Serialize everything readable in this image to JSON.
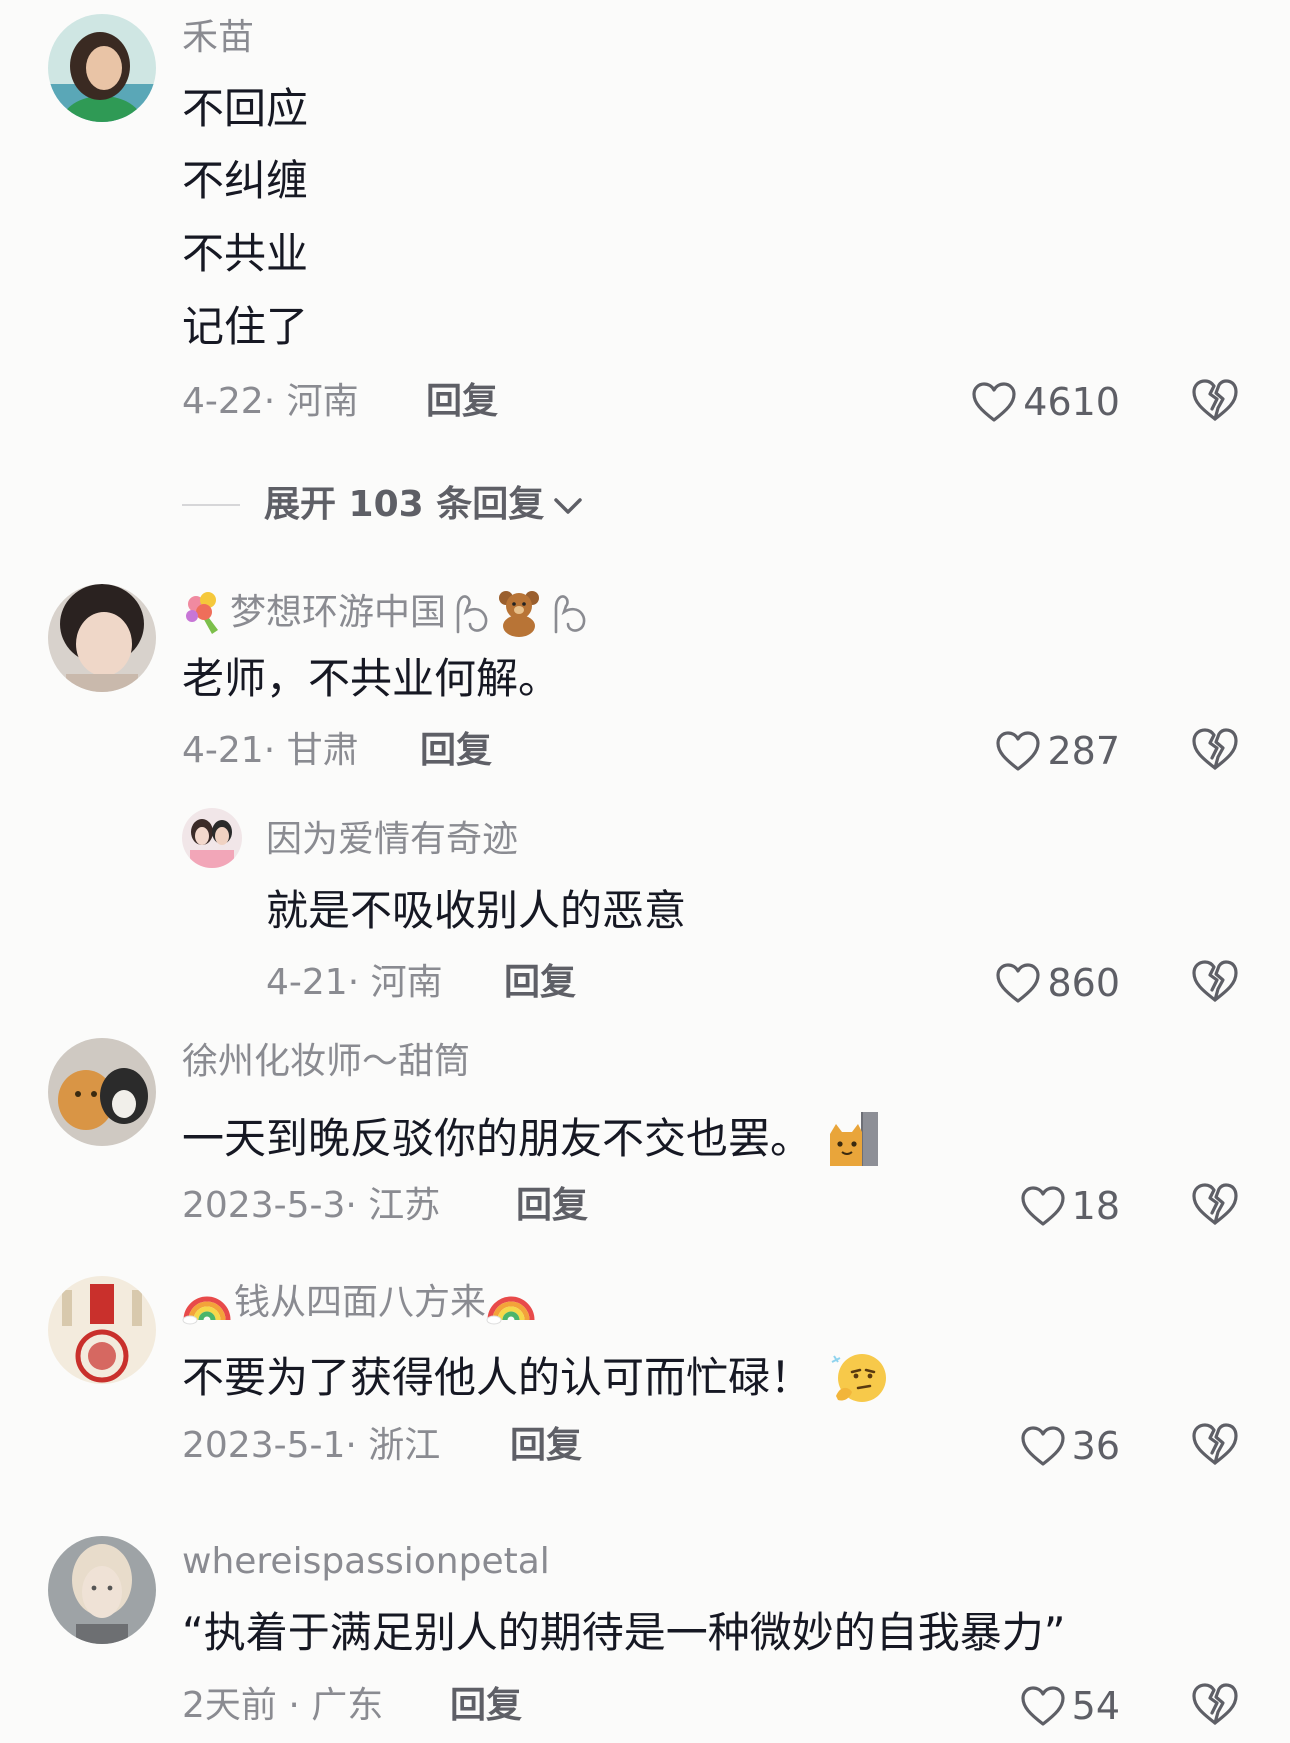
{
  "comments": [
    {
      "username": "禾苗",
      "lines": [
        "不回应",
        "不纠缠",
        "不共业",
        "记住了"
      ],
      "meta": "4-22· 河南",
      "reply_label": "回复",
      "likes": "4610"
    },
    {
      "username": "梦想环游中国",
      "lines": [
        "老师，不共业何解。"
      ],
      "meta": "4-21· 甘肃",
      "reply_label": "回复",
      "likes": "287"
    },
    {
      "username": "徐州化妆师～甜筒",
      "lines": [
        "一天到晚反驳你的朋友不交也罢。"
      ],
      "meta": "2023-5-3· 江苏",
      "reply_label": "回复",
      "likes": "18"
    },
    {
      "username": "钱从四面八方来",
      "lines": [
        "不要为了获得他人的认可而忙碌！"
      ],
      "meta": "2023-5-1· 浙江",
      "reply_label": "回复",
      "likes": "36"
    },
    {
      "username": "whereispassionpetal",
      "lines": [
        "“执着于满足别人的期待是一种微妙的自我暴力”"
      ],
      "meta": "2天前 · 广东",
      "reply_label": "回复",
      "likes": "54"
    }
  ],
  "expand": {
    "label": "展开 103 条回复"
  },
  "sub_reply": {
    "username": "因为爱情有奇迹",
    "text": "就是不吸收别人的恶意",
    "meta": "4-21· 河南",
    "reply_label": "回复",
    "likes": "860"
  },
  "colors": {
    "background": "#fbfbfa",
    "text_primary": "#161823",
    "text_secondary": "#8a8b91",
    "icon": "#5e5f66"
  }
}
